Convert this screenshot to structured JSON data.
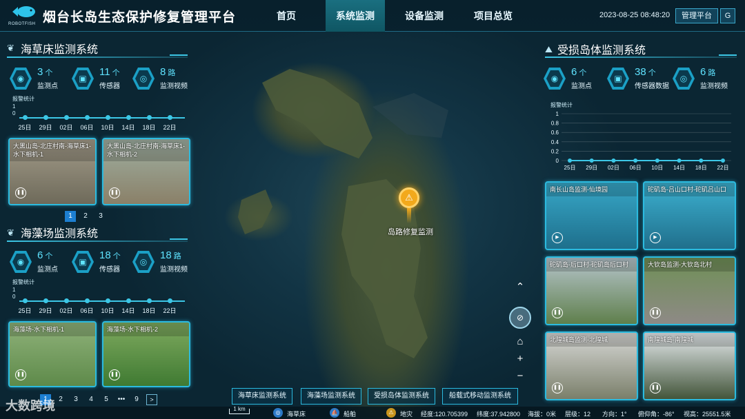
{
  "header": {
    "logo_text": "ROBOTFISH",
    "title": "烟台长岛生态保护修复管理平台",
    "nav": [
      {
        "label": "首页"
      },
      {
        "label": "系统监测"
      },
      {
        "label": "设备监测"
      },
      {
        "label": "项目总览"
      }
    ],
    "active_nav": "系统监测",
    "datetime": "2023-08-25 08:48:20",
    "admin_button": "管理平台",
    "logout_icon": "G"
  },
  "seagrass": {
    "title": "海草床监测系统",
    "stats": [
      {
        "value": "3",
        "unit": "个",
        "label": "监测点",
        "icon": "location-icon"
      },
      {
        "value": "11",
        "unit": "个",
        "label": "传感器",
        "icon": "sensor-icon"
      },
      {
        "value": "8",
        "unit": "路",
        "label": "监测视频",
        "icon": "camera-icon"
      }
    ],
    "alarm_label": "报警统计",
    "y_ticks": [
      "1",
      "0"
    ],
    "dates": [
      "25日",
      "29日",
      "02日",
      "06日",
      "10日",
      "14日",
      "18日",
      "22日"
    ],
    "cameras": [
      {
        "title": "大黑山岛-北庄村南-海草床1-水下相机-1"
      },
      {
        "title": "大黑山岛-北庄村南-海草床1-水下相机-2"
      }
    ],
    "pager": [
      "1",
      "2",
      "3"
    ]
  },
  "seaweed": {
    "title": "海藻场监测系统",
    "stats": [
      {
        "value": "6",
        "unit": "个",
        "label": "监测点",
        "icon": "location-icon"
      },
      {
        "value": "18",
        "unit": "个",
        "label": "传感器",
        "icon": "sensor-icon"
      },
      {
        "value": "18",
        "unit": "路",
        "label": "监测视频",
        "icon": "camera-icon"
      }
    ],
    "alarm_label": "报警统计",
    "y_ticks": [
      "1",
      "0"
    ],
    "dates": [
      "25日",
      "29日",
      "02日",
      "06日",
      "10日",
      "14日",
      "18日",
      "22日"
    ],
    "cameras": [
      {
        "title": "海藻场-水下相机-1"
      },
      {
        "title": "海藻场-水下相机-2"
      }
    ],
    "pager": [
      "1",
      "2",
      "3",
      "4",
      "5",
      "•••",
      "9"
    ]
  },
  "island": {
    "title": "受损岛体监测系统",
    "stats": [
      {
        "value": "6",
        "unit": "个",
        "label": "监测点",
        "icon": "location-icon"
      },
      {
        "value": "38",
        "unit": "个",
        "label": "传感器数据",
        "icon": "sensor-icon"
      },
      {
        "value": "6",
        "unit": "路",
        "label": "监测视频",
        "icon": "camera-icon"
      }
    ],
    "alarm_label": "报警统计",
    "cameras": [
      {
        "title": "南长山岛监测-仙境园"
      },
      {
        "title": "砣矶岛-吕山口村-砣矶吕山口"
      },
      {
        "title": "砣矶岛-后口村-砣矶岛后口村"
      },
      {
        "title": "大钦岛监测-大钦岛北村"
      },
      {
        "title": "北隍城岛监测-北隍城"
      },
      {
        "title": "南隍城岛-南隍城"
      }
    ]
  },
  "chart_data": {
    "type": "line",
    "title": "报警统计",
    "categories": [
      "25日",
      "29日",
      "02日",
      "06日",
      "10日",
      "14日",
      "18日",
      "22日"
    ],
    "values": [
      0,
      0,
      0,
      0,
      0,
      0,
      0,
      0
    ],
    "y_ticks": [
      "1",
      "0.8",
      "0.6",
      "0.4",
      "0.2",
      "0"
    ],
    "ylim": [
      0,
      1
    ],
    "grid": true,
    "series_color": "#3cc7e6"
  },
  "map": {
    "marker_label": "岛路修复监测",
    "scale": "1 km"
  },
  "bottom_tabs": [
    "海草床监测系统",
    "海藻场监测系统",
    "受损岛体监测系统",
    "船载式移动监测系统"
  ],
  "status": {
    "legend": [
      {
        "label": "海草床"
      },
      {
        "label": "船舶"
      },
      {
        "label": "地灾"
      }
    ],
    "longitude": "经度:120.705399",
    "latitude": "纬度:37.942800",
    "altitude": "海拔：0米",
    "level": "层级：12",
    "heading": "方向：1°",
    "pitch": "俯仰角：-86°",
    "view_height": "视高：25551.5米"
  },
  "watermark": "大数跨境"
}
